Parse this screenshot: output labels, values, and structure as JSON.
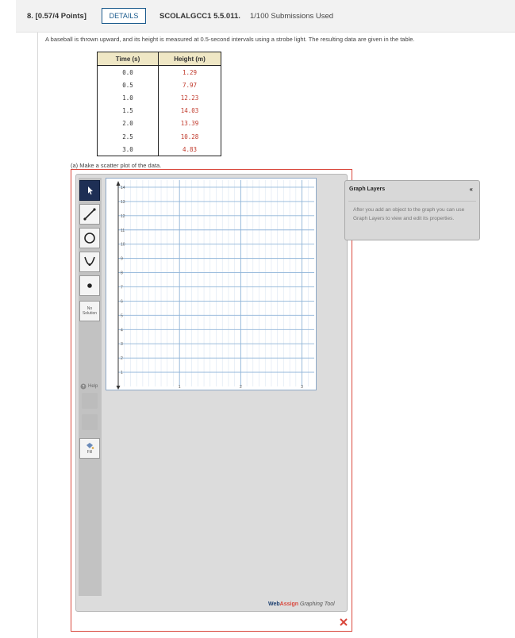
{
  "header": {
    "question_label": "8. [0.57/4 Points]",
    "details_label": "DETAILS",
    "assignment_code": "SCOLALGCC1 5.5.011.",
    "submissions": "1/100 Submissions Used"
  },
  "problem": {
    "text": "A baseball is thrown upward, and its height is measured at 0.5-second intervals using a strobe light. The resulting data are given in the table.",
    "part_a": "(a) Make a scatter plot of the data."
  },
  "table": {
    "headers": [
      "Time (s)",
      "Height (m)"
    ],
    "rows": [
      [
        "0.0",
        "1.29"
      ],
      [
        "0.5",
        "7.97"
      ],
      [
        "1.0",
        "12.23"
      ],
      [
        "1.5",
        "14.03"
      ],
      [
        "2.0",
        "13.39"
      ],
      [
        "2.5",
        "10.28"
      ],
      [
        "3.0",
        "4.83"
      ]
    ]
  },
  "graph_tool": {
    "tools": [
      {
        "name": "pointer",
        "icon": "pointer-arrow-icon",
        "active": true
      },
      {
        "name": "line",
        "icon": "line-tool-icon",
        "active": false
      },
      {
        "name": "circle",
        "icon": "circle-tool-icon",
        "active": false
      },
      {
        "name": "parabola",
        "icon": "parabola-tool-icon",
        "active": false
      },
      {
        "name": "point",
        "icon": "point-tool-icon",
        "active": false
      }
    ],
    "no_solution_label": "No Solution",
    "help_label": "Help",
    "fill_label": "Fill",
    "brand": {
      "web": "Web",
      "assign": "Assign",
      "suffix": "Graphing Tool"
    },
    "accent_color": "#1e2f55",
    "error_color": "#d9463b"
  },
  "chart_data": {
    "type": "scatter",
    "title": "",
    "xlabel": "",
    "ylabel": "",
    "xlim": [
      0,
      3.2
    ],
    "ylim": [
      0,
      14.5
    ],
    "x_ticks": [
      "1",
      "2",
      "3"
    ],
    "y_ticks": [
      "1",
      "2",
      "3",
      "4",
      "5",
      "6",
      "7",
      "8",
      "9",
      "10",
      "11",
      "12",
      "13",
      "14"
    ],
    "grid": true,
    "points": []
  },
  "graph_layers": {
    "title": "Graph Layers",
    "collapse_icon": "«",
    "message": "After you add an object to the graph you can use Graph Layers to view and edit its properties."
  }
}
